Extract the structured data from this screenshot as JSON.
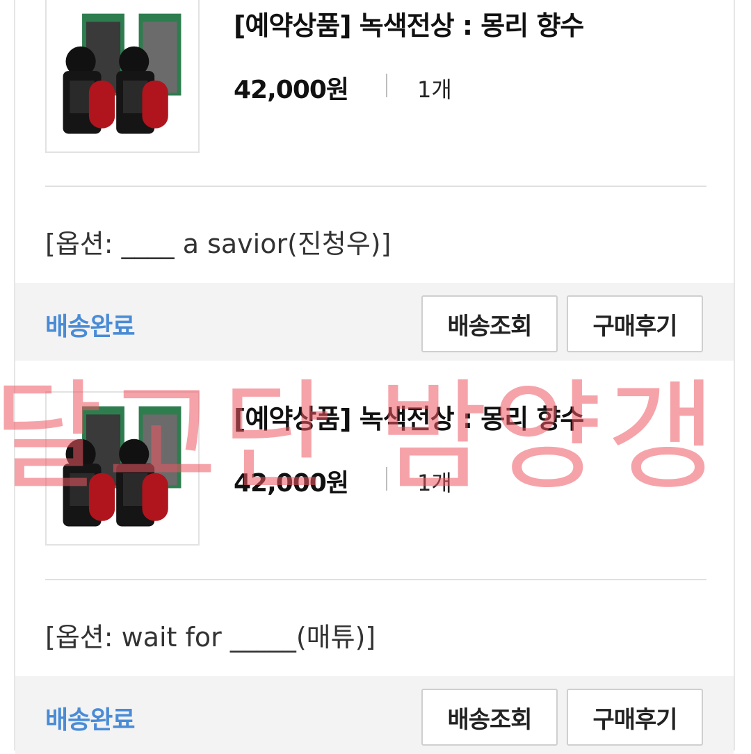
{
  "orders": [
    {
      "title": "[예약상품] 녹색전상 : 몽리 향수",
      "price": "42,000원",
      "quantity": "1개",
      "option": "[옵션: ____ a savior(진청우)]",
      "status": "배송완료",
      "track_button": "배송조회",
      "review_button": "구매후기"
    },
    {
      "title": "[예약상품] 녹색전상 : 몽리 향수",
      "price": "42,000원",
      "quantity": "1개",
      "option": "[옵션: wait for _____(매튜)]",
      "status": "배송완료",
      "track_button": "배송조회",
      "review_button": "구매후기"
    }
  ],
  "watermark": "달고단 밤양갱",
  "colors": {
    "status": "#4a8bd6",
    "watermark": "#ec5862",
    "status_bar": "#f3f3f3"
  }
}
